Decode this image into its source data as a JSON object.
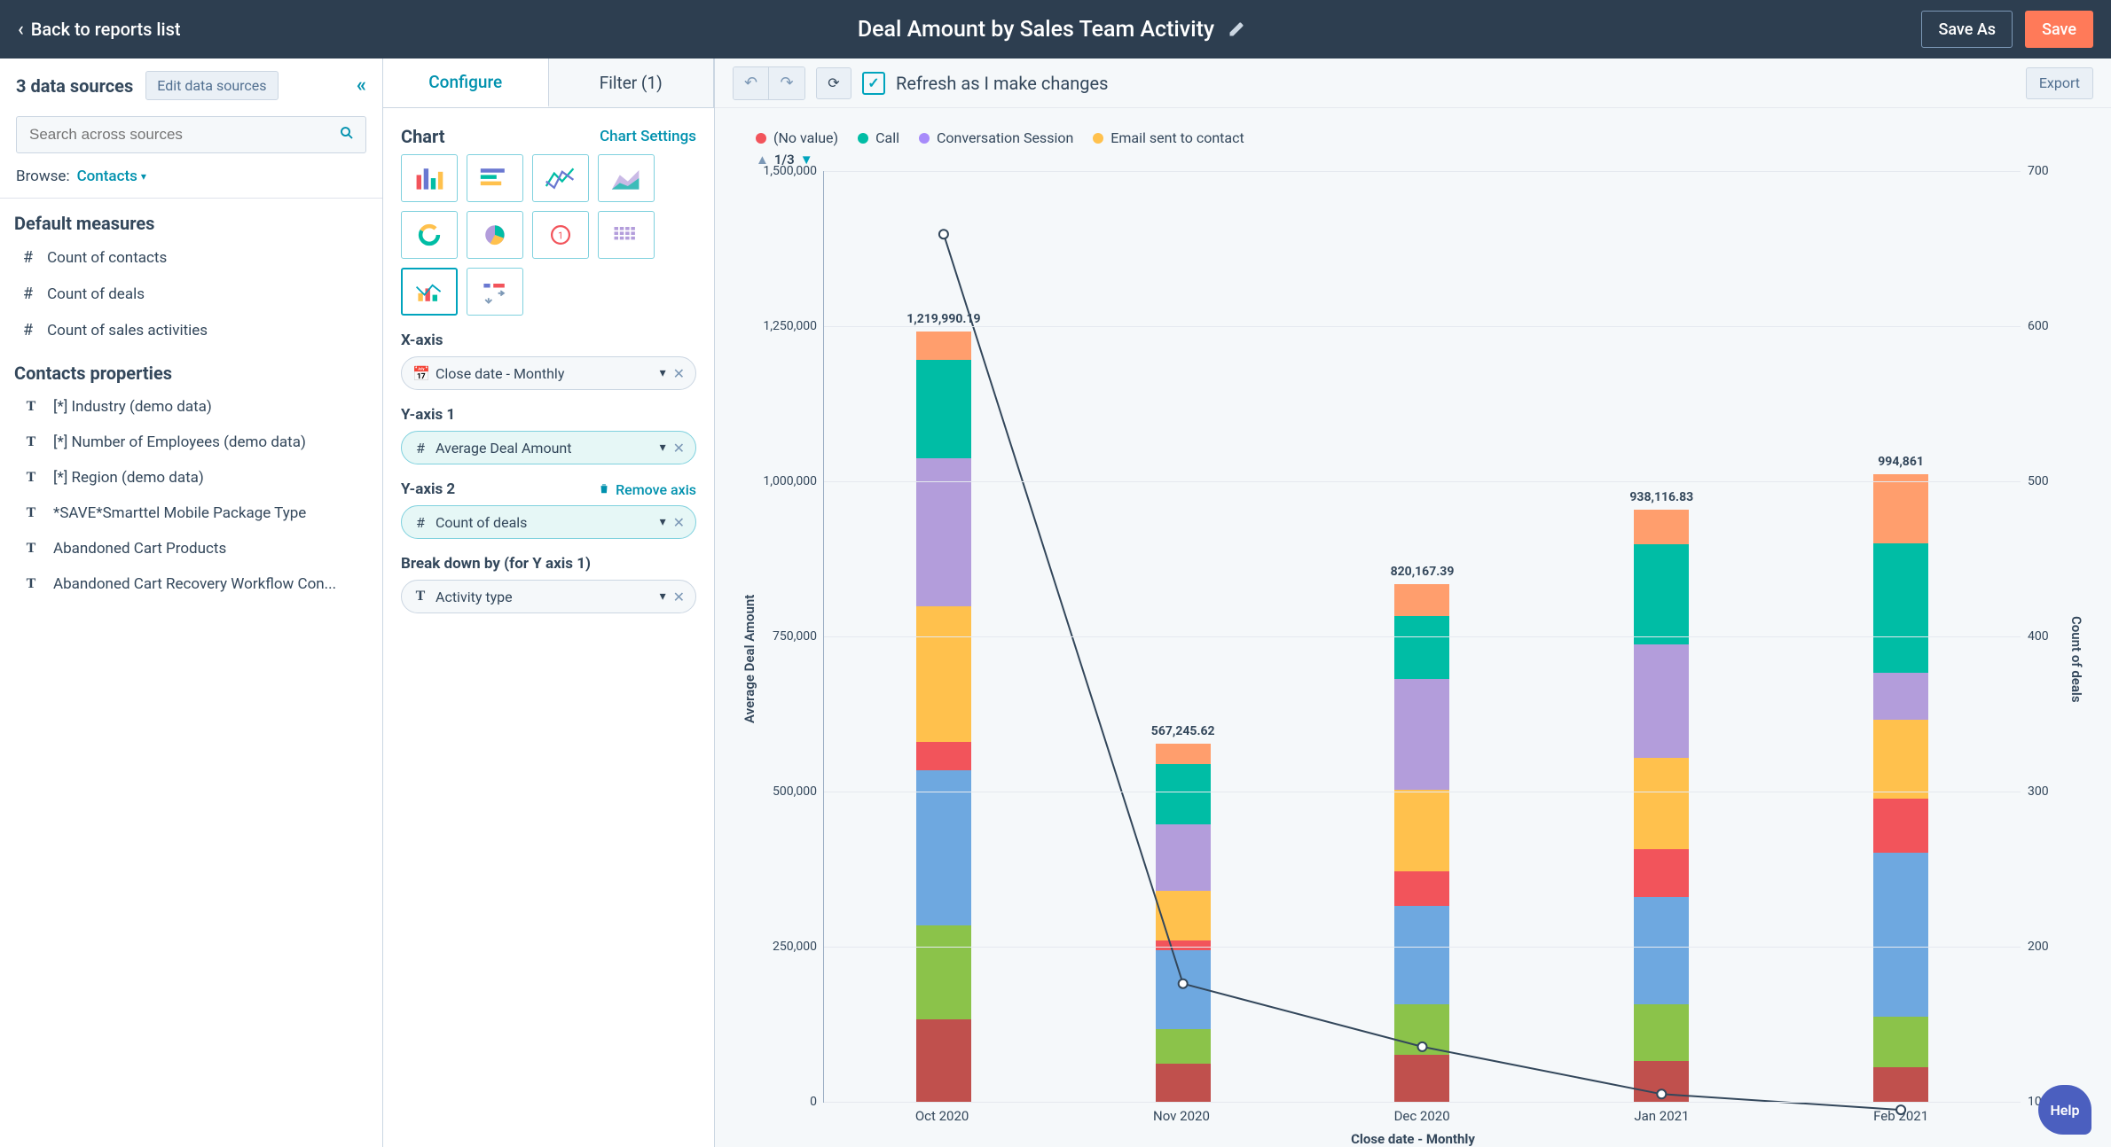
{
  "topbar": {
    "back_label": "Back to reports list",
    "title": "Deal Amount by Sales Team Activity",
    "save_as": "Save As",
    "save": "Save"
  },
  "sidebar": {
    "sources_count_label": "3 data sources",
    "edit_sources": "Edit data sources",
    "search_placeholder": "Search across sources",
    "browse_label": "Browse:",
    "browse_value": "Contacts",
    "section1_title": "Default measures",
    "measures": [
      {
        "icon": "#",
        "label": "Count of contacts"
      },
      {
        "icon": "#",
        "label": "Count of deals"
      },
      {
        "icon": "#",
        "label": "Count of sales activities"
      }
    ],
    "section2_title": "Contacts properties",
    "properties": [
      {
        "icon": "T",
        "label": "[*] Industry (demo data)"
      },
      {
        "icon": "T",
        "label": "[*] Number of Employees (demo data)"
      },
      {
        "icon": "T",
        "label": "[*] Region (demo data)"
      },
      {
        "icon": "T",
        "label": "*SAVE*Smarttel Mobile Package Type"
      },
      {
        "icon": "T",
        "label": "Abandoned Cart Products"
      },
      {
        "icon": "T",
        "label": "Abandoned Cart Recovery Workflow Con..."
      }
    ]
  },
  "config": {
    "tabs": {
      "configure": "Configure",
      "filter": "Filter (1)"
    },
    "chart_head": "Chart",
    "chart_settings": "Chart Settings",
    "xaxis_label": "X-axis",
    "xaxis_value": "Close date - Monthly",
    "y1_label": "Y-axis 1",
    "y1_value": "Average Deal Amount",
    "y2_label": "Y-axis 2",
    "y2_remove": "Remove axis",
    "y2_value": "Count of deals",
    "breakdown_label": "Break down by (for Y axis 1)",
    "breakdown_value": "Activity type"
  },
  "toolbar": {
    "refresh_label": "Refresh as I make changes",
    "export": "Export"
  },
  "legend": {
    "pager": "1/3",
    "items": [
      {
        "name": "(No value)",
        "color": "#f2545b"
      },
      {
        "name": "Call",
        "color": "#00bda5"
      },
      {
        "name": "Conversation Session",
        "color": "#a78bfa"
      },
      {
        "name": "Email sent to contact",
        "color": "#ffc14d"
      }
    ]
  },
  "help": "Help",
  "chart_data": {
    "type": "bar",
    "title": "",
    "xlabel": "Close date - Monthly",
    "ylabel": "Average Deal Amount",
    "y2label": "Count of deals",
    "ylim": [
      0,
      1500000
    ],
    "y2lim": [
      100,
      700
    ],
    "y_ticks": [
      0,
      250000,
      500000,
      750000,
      1000000,
      1250000,
      1500000
    ],
    "y_tick_labels": [
      "0",
      "250,000",
      "500,000",
      "750,000",
      "1,000,000",
      "1,250,000",
      "1,500,000"
    ],
    "y2_ticks": [
      100,
      200,
      300,
      400,
      500,
      600,
      700
    ],
    "categories": [
      "Oct 2020",
      "Nov 2020",
      "Dec 2020",
      "Jan 2021",
      "Feb 2021"
    ],
    "totals": [
      "1,219,990.19",
      "567,245.62",
      "820,167.39",
      "938,116.83",
      "994,861"
    ],
    "series_colors": [
      "#c0504d",
      "#8bc34a",
      "#6ea8e0",
      "#f2545b",
      "#ffc14d",
      "#b39ddb",
      "#00bda5",
      "#ff9e6d"
    ],
    "stacked_values": [
      [
        130000,
        150000,
        245000,
        45000,
        215000,
        235000,
        155000,
        45000
      ],
      [
        60000,
        55000,
        125000,
        15000,
        80000,
        105000,
        95000,
        32000
      ],
      [
        75000,
        80000,
        155000,
        55000,
        130000,
        175000,
        100000,
        50000
      ],
      [
        65000,
        90000,
        170000,
        75000,
        145000,
        180000,
        158000,
        55000
      ],
      [
        55000,
        80000,
        260000,
        85000,
        125000,
        75000,
        205000,
        110000
      ]
    ],
    "line_series": {
      "name": "Count of deals",
      "values": [
        660,
        185,
        145,
        115,
        105
      ]
    }
  }
}
